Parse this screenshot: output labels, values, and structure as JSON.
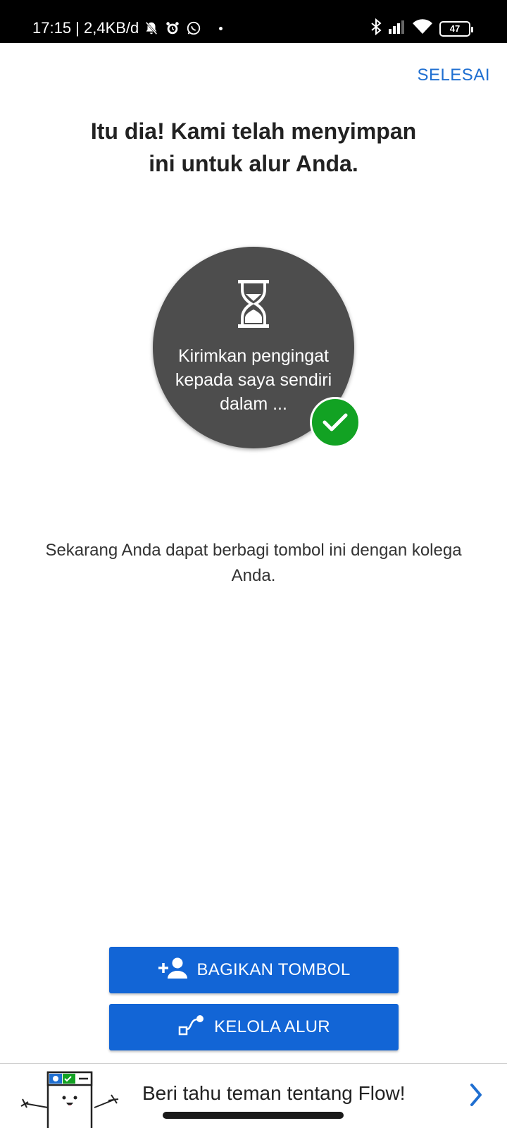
{
  "status_bar": {
    "time_info": "17:15 | 2,4KB/d",
    "battery": "47",
    "icons": [
      "mute-bell-icon",
      "alarm-icon",
      "whatsapp-icon",
      "bluetooth-icon",
      "signal-icon",
      "wifi-icon",
      "battery-icon"
    ]
  },
  "header": {
    "done_label": "SELESAI"
  },
  "main": {
    "headline": "Itu dia! Kami telah menyimpan ini untuk alur Anda.",
    "circle_text": "Kirimkan pengingat kepada saya sendiri dalam ...",
    "description": "Sekarang Anda dapat berbagi tombol ini dengan kolega Anda."
  },
  "actions": {
    "share_label": "BAGIKAN TOMBOL",
    "manage_label": "KELOLA ALUR"
  },
  "footer": {
    "promo_text": "Beri tahu teman tentang Flow!"
  },
  "colors": {
    "accent": "#1265d6",
    "link": "#1f6fd1",
    "success": "#12a223",
    "circle": "#4d4d4d"
  }
}
